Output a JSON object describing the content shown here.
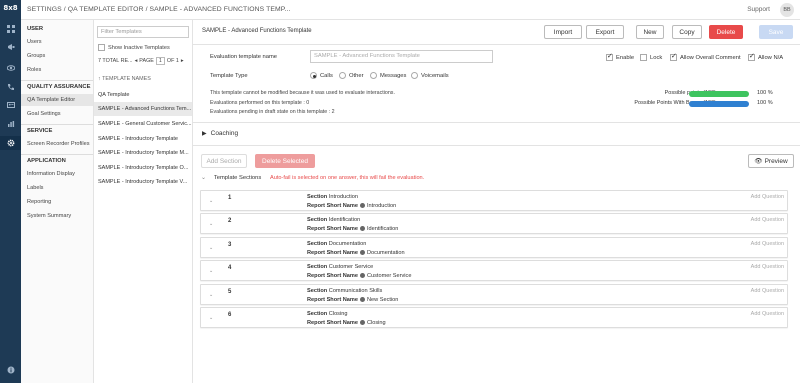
{
  "app": {
    "logo": "8x8",
    "breadcrumb": "SETTINGS / QA TEMPLATE EDITOR / SAMPLE - ADVANCED FUNCTIONS TEMP...",
    "support": "Support",
    "avatar": "BB"
  },
  "rail_icons": [
    "apps-icon",
    "megaphone-icon",
    "eye-icon",
    "phone-icon",
    "contact-card-icon",
    "bar-chart-icon",
    "gear-icon"
  ],
  "nav": {
    "user_header": "USER",
    "user_items": [
      "Users",
      "Groups",
      "Roles"
    ],
    "qa_header": "QUALITY ASSURANCE",
    "qa_items": [
      "QA Template Editor",
      "Goal Settings"
    ],
    "service_header": "SERVICE",
    "service_items": [
      "Screen Recorder Profiles"
    ],
    "application_header": "APPLICATION",
    "application_items": [
      "Information Display",
      "Labels",
      "Reporting",
      "System Summary"
    ]
  },
  "template_list": {
    "filter_placeholder": "Filter Templates",
    "show_inactive": "Show Inactive Templates",
    "total": "7 TOTAL RE...",
    "page_label": "PAGE",
    "page_value": "1",
    "of_label": "OF 1",
    "column": "TEMPLATE NAMES",
    "items": [
      "QA Template",
      "SAMPLE - Advanced Functions Tem...",
      "SAMPLE - General Customer Servic...",
      "SAMPLE - Introductory Template",
      "SAMPLE - Introductory Template M...",
      "SAMPLE - Introductory Template O...",
      "SAMPLE - Introductory Template V..."
    ]
  },
  "editor": {
    "title": "SAMPLE - Advanced Functions Template",
    "buttons": {
      "import": "Import",
      "export": "Export",
      "new": "New",
      "copy": "Copy",
      "delete": "Delete",
      "save": "Save"
    },
    "name_label": "Evaluation template name",
    "name_value": "SAMPLE - Advanced Functions Template",
    "options": {
      "enable": "Enable",
      "lock": "Lock",
      "allow_overall_comment": "Allow Overall Comment",
      "allow_na": "Allow N/A"
    },
    "type_label": "Template Type",
    "types": [
      "Calls",
      "Other",
      "Messages",
      "Voicemails"
    ],
    "selected_type": "Calls",
    "info_lines": [
      "This template cannot be modified because it was used to evaluate interactions.",
      "Evaluations performed on this template : 0",
      "Evaluations pending in draft state on this template : 2"
    ],
    "points": [
      {
        "label": "Possible points (100)",
        "percent_text": "100 %",
        "fill": 1.0,
        "color": "#3ec45f"
      },
      {
        "label": "Possible Points With Bonus (100)",
        "percent_text": "100 %",
        "fill": 1.0,
        "color": "#2f80d1"
      }
    ],
    "coaching": "Coaching",
    "add_section": "Add Section",
    "delete_selected": "Delete Selected",
    "preview": "Preview",
    "sections_title": "Template Sections",
    "autofail_note": "Auto-fail is selected on one answer, this will fail the evaluation.",
    "section_label": "Section",
    "short_label": "Report Short Name",
    "add_question": "Add Question",
    "sections": [
      {
        "num": "1",
        "name": "Introduction",
        "short": "Introduction"
      },
      {
        "num": "2",
        "name": "Identification",
        "short": "Identification"
      },
      {
        "num": "3",
        "name": "Documentation",
        "short": "Documentation"
      },
      {
        "num": "4",
        "name": "Customer Service",
        "short": "Customer Service"
      },
      {
        "num": "5",
        "name": "Communication Skills",
        "short": "New Section"
      },
      {
        "num": "6",
        "name": "Closing",
        "short": "Closing"
      }
    ]
  }
}
